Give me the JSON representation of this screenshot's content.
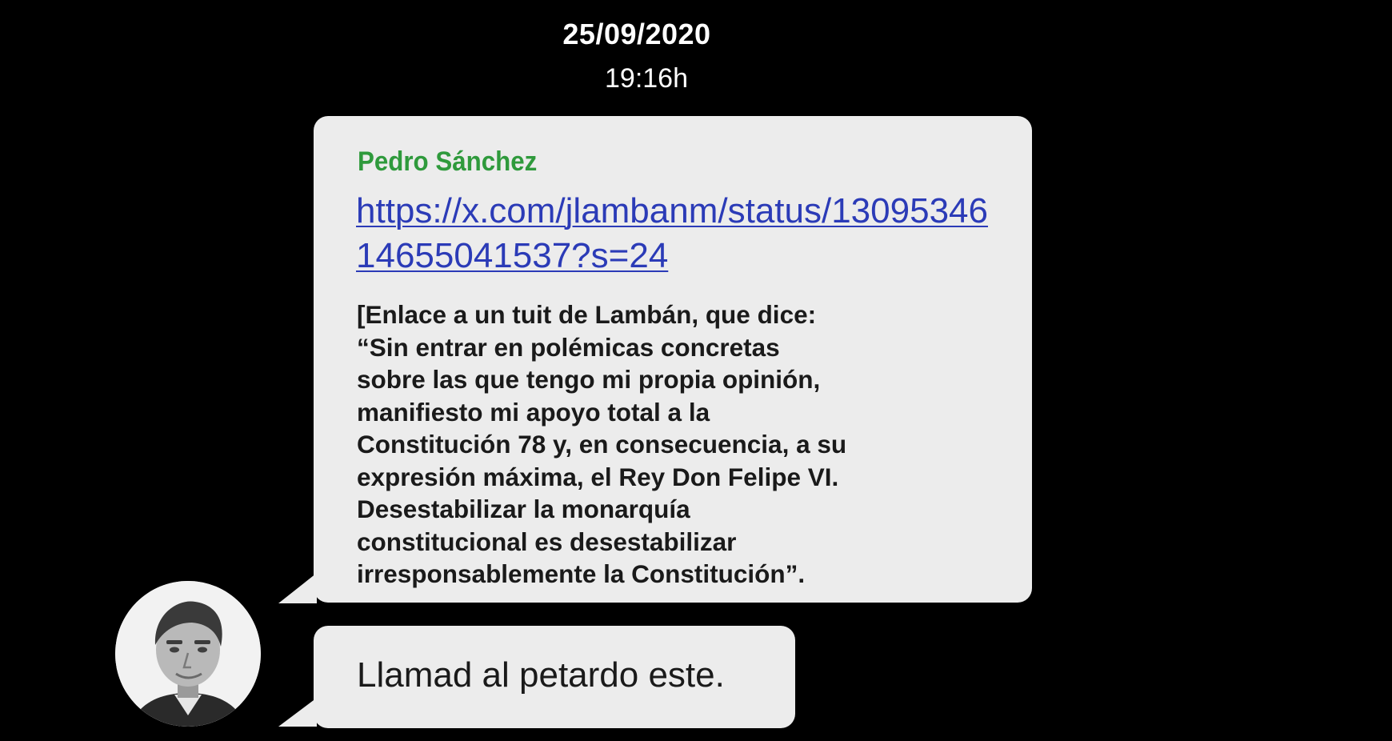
{
  "header": {
    "date": "25/09/2020",
    "time": "19:16h"
  },
  "message_1": {
    "sender": "Pedro Sánchez",
    "link": "https://x.com/jlambanm/status/1309534614655041537?s=24",
    "body": "[Enlace a un tuit de Lambán, que dice:\n“Sin entrar en polémicas concretas\nsobre las que tengo mi propia opinión,\nmanifiesto mi apoyo total a la\nConstitución 78 y, en consecuencia, a su\nexpresión máxima, el Rey Don Felipe VI.\nDesestabilizar la monarquía\nconstitucional es desestabilizar\nirresponsablemente la Constitución”."
  },
  "message_2": {
    "text": "Llamad al petardo este."
  },
  "colors": {
    "background": "#000000",
    "bubble": "#ececec",
    "sender": "#2f9a3c",
    "link": "#2b3bb7"
  },
  "icons": {
    "avatar": "avatar-photo"
  }
}
